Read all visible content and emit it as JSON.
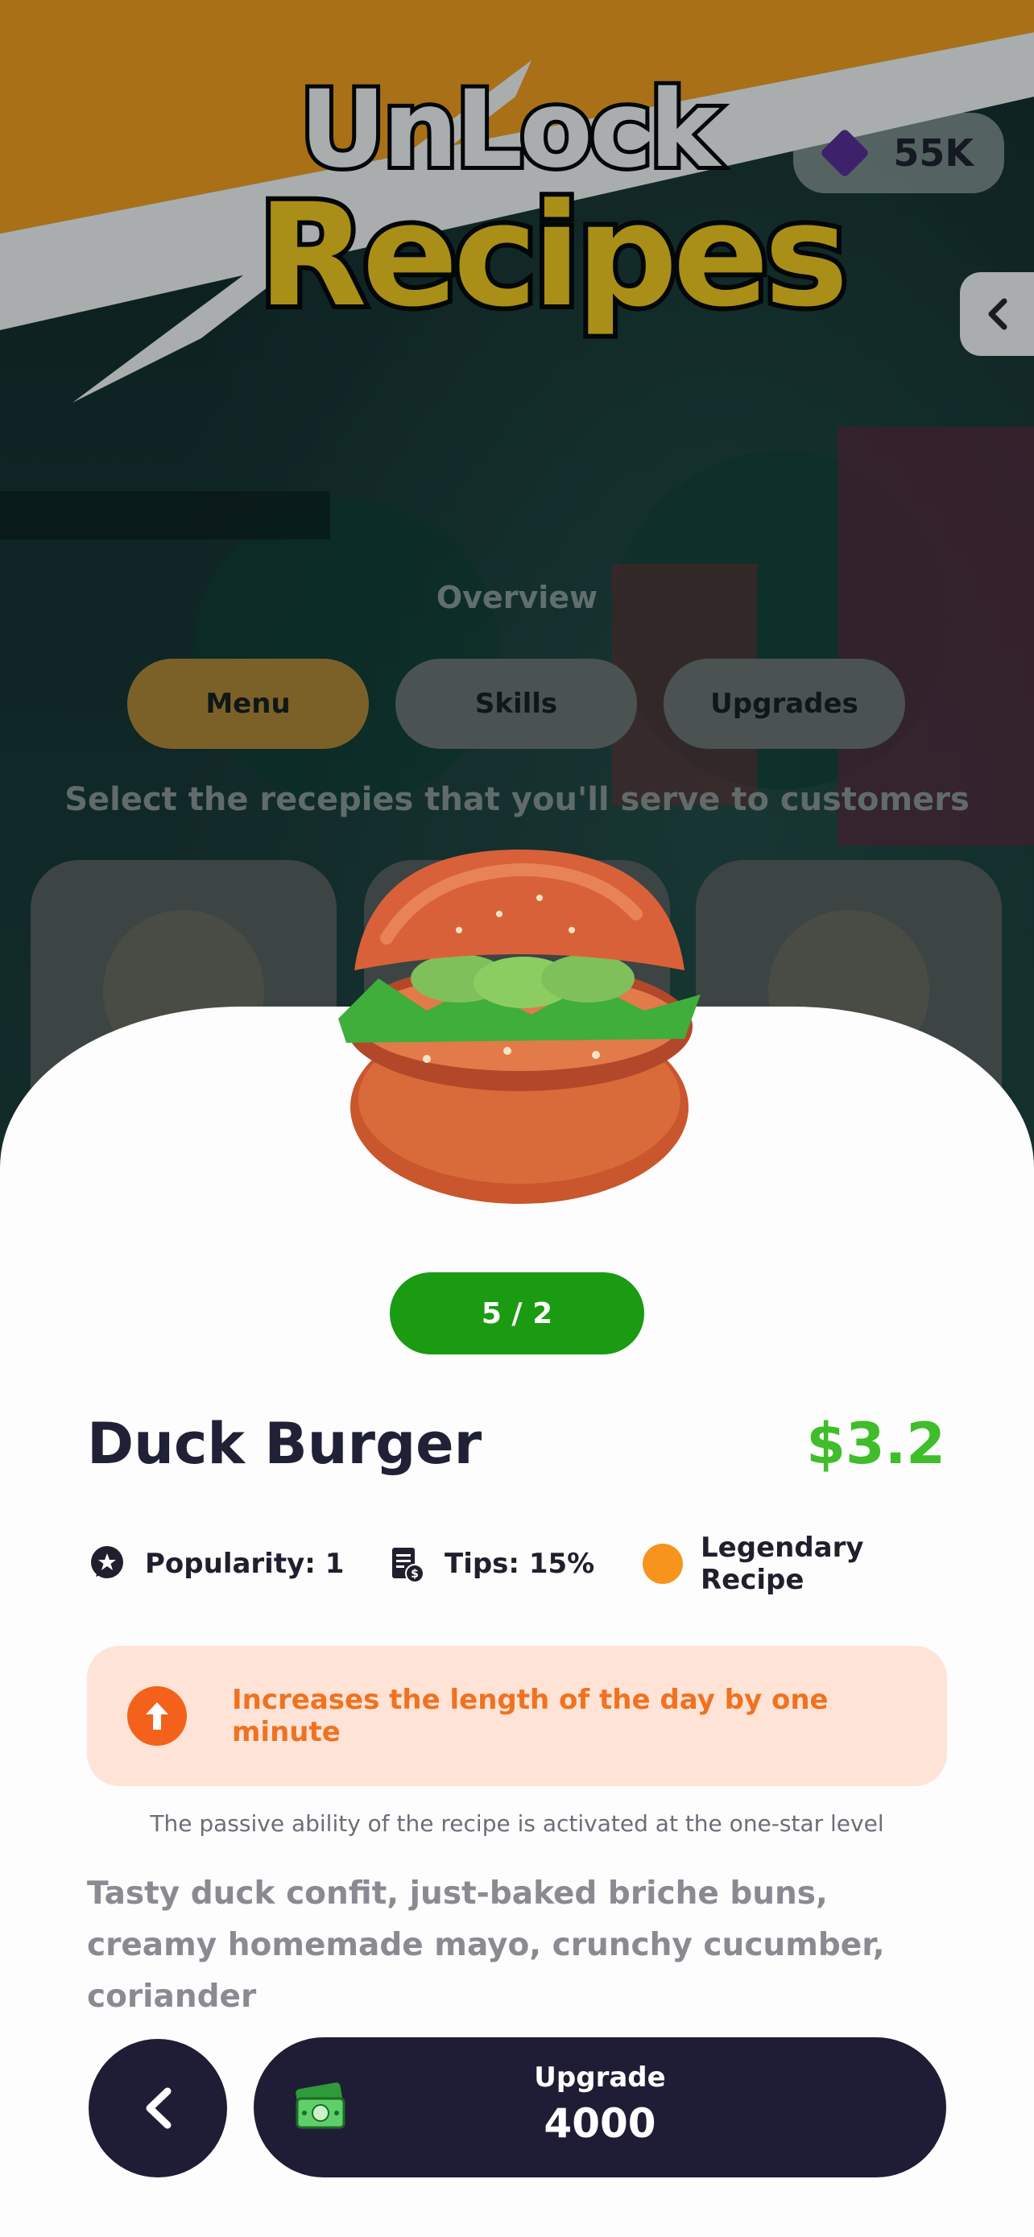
{
  "header": {
    "title_line1": "UnLock",
    "title_line2": "Recipes",
    "currency": {
      "amount": "55K",
      "icon": "gem-icon"
    },
    "side_back_icon": "chevron-left-icon"
  },
  "background": {
    "overview_label": "Overview",
    "tabs": [
      {
        "label": "Menu",
        "active": true
      },
      {
        "label": "Skills",
        "active": false
      },
      {
        "label": "Upgrades",
        "active": false
      }
    ],
    "subtitle": "Select the recepies that you'll serve to customers"
  },
  "recipe": {
    "counter": "5 / 2",
    "name": "Duck Burger",
    "price": "$3.2",
    "stats": {
      "popularity": "Popularity: 1",
      "tips": "Tips: 15%",
      "rarity": "Legendary Recipe"
    },
    "ability": "Increases the length of the day by one minute",
    "ability_note": "The passive ability of the recipe is activated at the one-star level",
    "description": "Tasty duck confit, just-baked briche buns, creamy homemade mayo, crunchy cucumber, coriander"
  },
  "actions": {
    "upgrade_label": "Upgrade",
    "upgrade_cost": "4000"
  },
  "colors": {
    "accent_green": "#1a9b12",
    "price_green": "#3fbd2a",
    "banner_orange": "#ffa21a",
    "title_yellow": "#ffd21a",
    "ability_orange": "#f4611a",
    "dark_button": "#1f1d35"
  }
}
